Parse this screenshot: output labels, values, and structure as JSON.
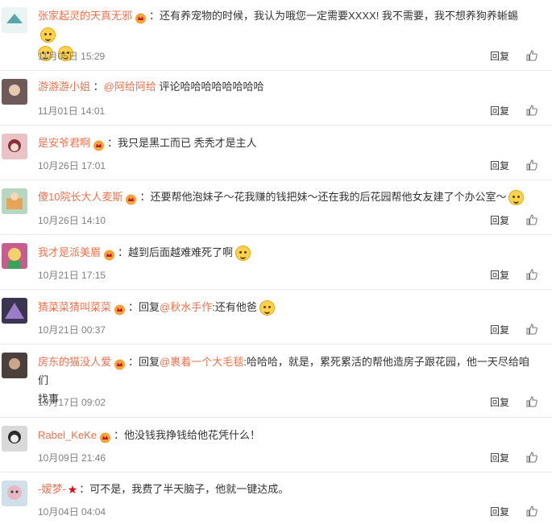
{
  "comments": [
    {
      "username": "张家起灵的天真无邪",
      "text": "：还有养宠物的时候，我认为哦您一定需要XXXX! 我不需要，我不想养狗养蜥蜴",
      "date": "11月05日 15:29",
      "reply_label": "回复",
      "avatar_color": "#eaf4f4",
      "avatar_accent": "#5aa6a6"
    },
    {
      "username": "游游游小姐",
      "text": "：@阿给阿给 评论哈哈哈哈哈哈哈哈",
      "mention": "@阿给阿给",
      "text_after": " 评论哈哈哈哈哈哈哈哈",
      "date": "11月01日 14:01",
      "reply_label": "回复",
      "avatar_color": "#6e5a58",
      "avatar_accent": "#e7c8b0"
    },
    {
      "username": "是安爷君啊",
      "text": "：我只是黑工而已 秃秃才是主人",
      "date": "10月26日 17:01",
      "reply_label": "回复",
      "avatar_color": "#e9c3c6",
      "avatar_accent": "#8b2f3a"
    },
    {
      "username": "傻10院长大人麦斯",
      "text": "：还要帮他泡妹子～花我赚的钱把妹～还在我的后花园帮他女友建了个办公室～",
      "date": "10月26日 14:10",
      "reply_label": "回复",
      "avatar_color": "#b8d7c2",
      "avatar_accent": "#e6a35a"
    },
    {
      "username": "我才是派美眉",
      "text": "：越到后面越难难死了啊",
      "date": "10月21日 17:15",
      "reply_label": "回复",
      "avatar_color": "#c95c8f",
      "avatar_accent": "#f2d36b"
    },
    {
      "username": "猜菜菜猜叫菜菜",
      "text_before": "：回复",
      "mention": "@秋水手作",
      "text_after": ":还有他爸",
      "date": "10月21日 00:37",
      "reply_label": "回复",
      "avatar_color": "#3b3552",
      "avatar_accent": "#9b7dc9"
    },
    {
      "username": "房东的猫没人爱",
      "text_before": "：回复",
      "mention": "@裹着一个大毛毯",
      "text_after": ":哈哈哈，就是，累死累活的帮他造房子跟花园，他一天尽给咱们",
      "text_line2": "找事",
      "date": "10月17日 09:02",
      "reply_label": "回复",
      "avatar_color": "#4a3f3c",
      "avatar_accent": "#c9a58c"
    },
    {
      "username": "Rabel_KeKe",
      "text": "：他没钱我挣钱给他花凭什么！",
      "date": "10月09日 21:46",
      "reply_label": "回复",
      "avatar_color": "#d9d9d9",
      "avatar_accent": "#2b2b2b"
    },
    {
      "username": "-嫒梦-",
      "text": "：可不是，我费了半天脑子，他就一键达成。",
      "date": "10月04日 04:04",
      "reply_label": "回复",
      "avatar_color": "#cfe0ea",
      "avatar_accent": "#e8b7c4"
    }
  ],
  "colors": {
    "username": "#eb7350",
    "meta": "#808080",
    "text": "#333333",
    "divider": "#eaeaea"
  },
  "icons": {
    "badge": "vip-crown-icon",
    "like": "thumbs-up-icon",
    "emoji": "smiley-emoji-icon",
    "star": "red-star-icon"
  }
}
